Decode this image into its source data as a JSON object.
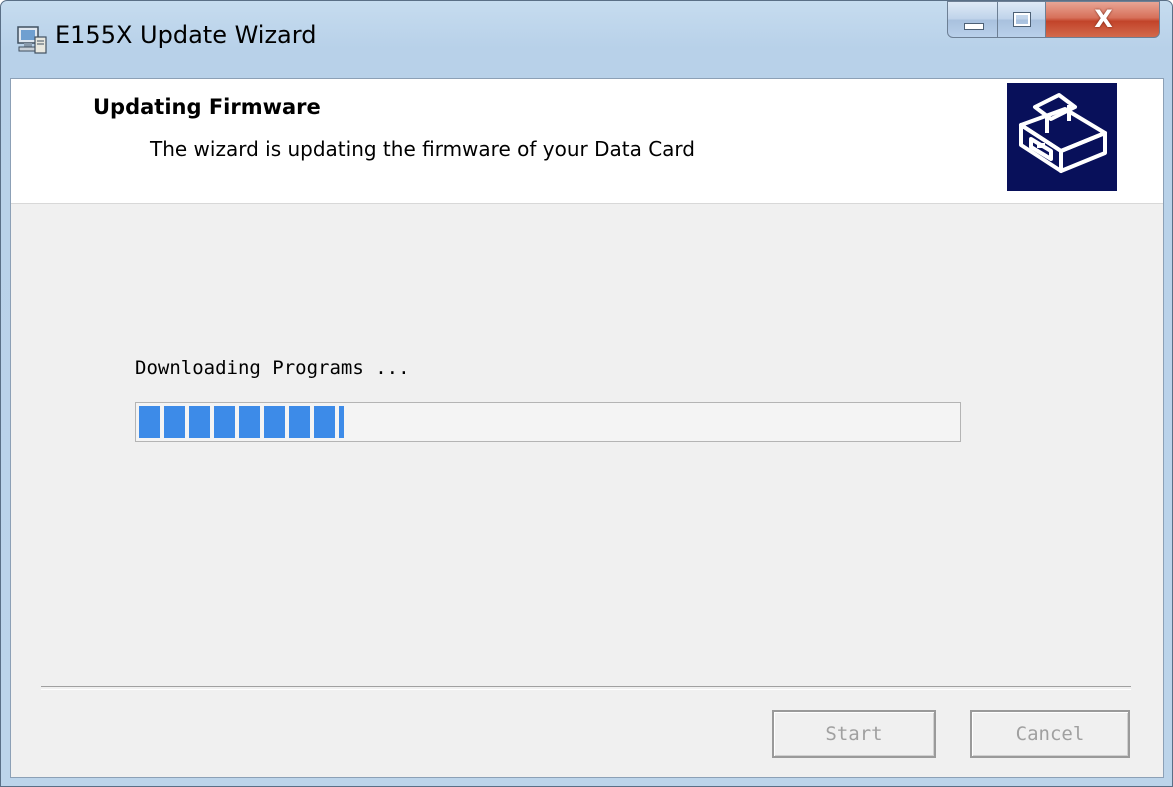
{
  "window": {
    "title": "E155X Update Wizard",
    "title_icon": "setup-computer-icon",
    "controls": {
      "minimize_icon": "minimize-icon",
      "maximize_icon": "maximize-icon",
      "close_icon": "close-icon",
      "close_glyph": "X"
    }
  },
  "header": {
    "title": "Updating Firmware",
    "subtitle": "The wizard is updating the firmware of your Data Card",
    "graphic_icon": "data-card-drive-icon"
  },
  "progress": {
    "status_text": "Downloading Programs ...",
    "fraction": 0.25
  },
  "buttons": {
    "start_label": "Start",
    "cancel_label": "Cancel",
    "start_enabled": false,
    "cancel_enabled": false
  },
  "colors": {
    "progress_fill": "#3d8be8",
    "header_graphic_bg": "#08105a",
    "close_button": "#c2442a"
  }
}
